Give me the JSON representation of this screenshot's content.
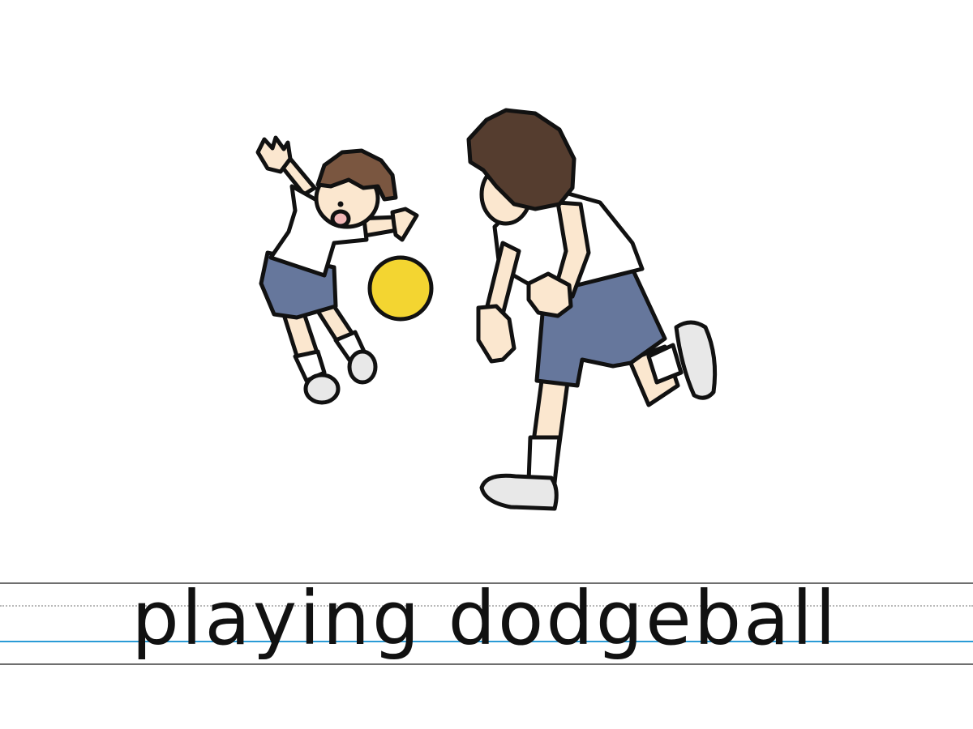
{
  "caption": {
    "text": "playing dodgeball"
  },
  "colors": {
    "outline": "#111111",
    "hair_small_boy": "#7a5640",
    "hair_big_boy": "#553d2f",
    "skin": "#fbe7cf",
    "shirt": "#ffffff",
    "shorts": "#66779c",
    "sock": "#ffffff",
    "shoe": "#e8e8e8",
    "ball": "#f3d531",
    "guide_line_gray": "#6f6f6f",
    "guide_line_dotted": "#b9b9b9",
    "guide_line_blue": "#2a9bd6"
  },
  "illustration": {
    "figures": [
      "small-boy-icon",
      "ball-icon",
      "big-boy-icon"
    ]
  }
}
